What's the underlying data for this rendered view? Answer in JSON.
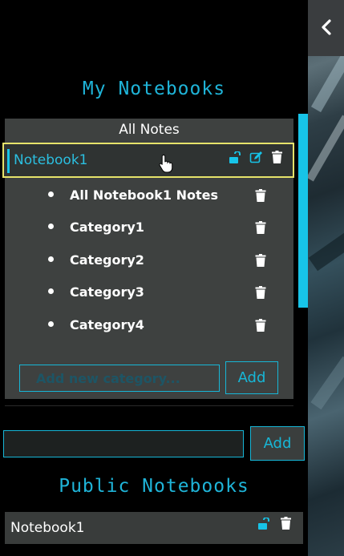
{
  "header": {
    "back_icon": "chevron-left-icon"
  },
  "my_notebooks": {
    "title": "My Notebooks",
    "all_notes_label": "All Notes",
    "notebook": {
      "label": "Notebook1",
      "icons": [
        "unlock-icon",
        "edit-icon",
        "trash-icon"
      ]
    },
    "categories": [
      {
        "label": "All Notebook1 Notes"
      },
      {
        "label": "Category1"
      },
      {
        "label": "Category2"
      },
      {
        "label": "Category3"
      },
      {
        "label": "Category4"
      }
    ],
    "add_category": {
      "placeholder": "Add new category...",
      "value": "",
      "button_label": "Add"
    }
  },
  "new_notebook": {
    "value": "",
    "button_label": "Add"
  },
  "public_notebooks": {
    "title": "Public Notebooks",
    "items": [
      {
        "label": "Notebook1"
      }
    ]
  },
  "colors": {
    "accent": "#17c4e8",
    "title": "#1fb4d8",
    "hover_border": "#e6e36a",
    "panel_bg": "#3e4140"
  }
}
